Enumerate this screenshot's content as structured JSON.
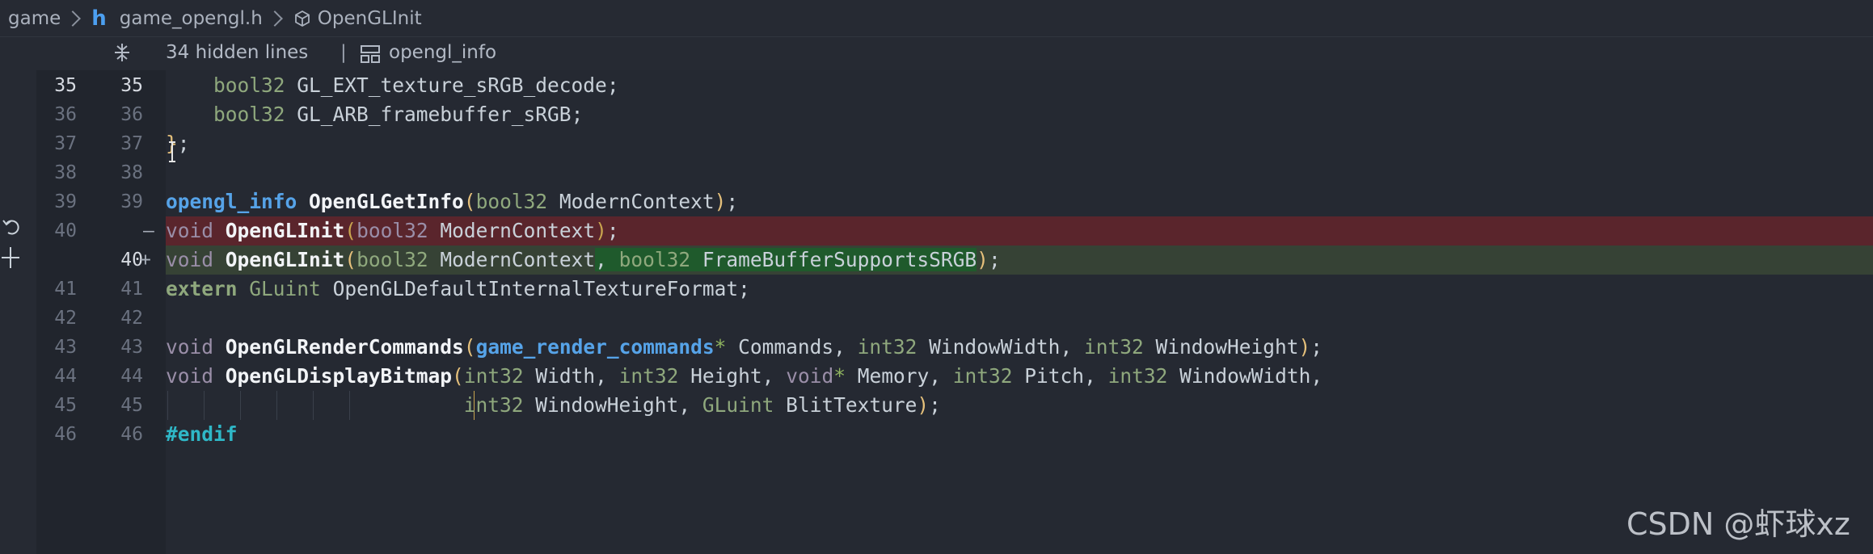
{
  "breadcrumb": {
    "root": "game",
    "file": "game_opengl.h",
    "file_icon": "h",
    "symbol": "OpenGLInit"
  },
  "sticky": {
    "hidden_lines": "34 hidden lines",
    "separator": "|",
    "struct_name": "opengl_info"
  },
  "lines": {
    "l35": {
      "old": "35",
      "new": "35"
    },
    "l36": {
      "old": "36",
      "new": "36"
    },
    "l37": {
      "old": "37",
      "new": "37"
    },
    "l38": {
      "old": "38",
      "new": "38"
    },
    "l39": {
      "old": "39",
      "new": "39"
    },
    "l40r": {
      "old": "40",
      "mark": "—"
    },
    "l40a": {
      "new": "40",
      "mark": "+"
    },
    "l41": {
      "old": "41",
      "new": "41"
    },
    "l42": {
      "old": "42",
      "new": "42"
    },
    "l43": {
      "old": "43",
      "new": "43"
    },
    "l44": {
      "old": "44",
      "new": "44"
    },
    "l45": {
      "old": "45",
      "new": "45"
    },
    "l46": {
      "old": "46",
      "new": "46"
    }
  },
  "code": {
    "bool32": "bool32",
    "void": "void",
    "extern": "extern",
    "int32": "int32",
    "GLuint": "GLuint",
    "l35_name": "GL_EXT_texture_sRGB_decode",
    "l36_name": "GL_ARB_framebuffer_sRGB",
    "semi": ";",
    "brace_close": "}",
    "opengl_info": "opengl_info",
    "OpenGLGetInfo": "OpenGLGetInfo",
    "OpenGLInit": "OpenGLInit",
    "ModernContext": "ModernContext",
    "FrameBufferSupportsSRGB": "FrameBufferSupportsSRGB",
    "OpenGLDefaultInternalTextureFormat": "OpenGLDefaultInternalTextureFormat",
    "OpenGLRenderCommands": "OpenGLRenderCommands",
    "game_render_commands": "game_render_commands",
    "Commands": "Commands",
    "WindowWidth": "WindowWidth",
    "WindowHeight": "WindowHeight",
    "OpenGLDisplayBitmap": "OpenGLDisplayBitmap",
    "Width": "Width",
    "Height": "Height",
    "Memory": "Memory",
    "Pitch": "Pitch",
    "BlitTexture": "BlitTexture",
    "endif": "#endif"
  },
  "watermark": "CSDN @虾球xz",
  "colors": {
    "removed_bg": "#5a252c",
    "added_bg": "#364235",
    "added_highlight": "#1f5a2c",
    "type_blue": "#56a3e8",
    "keyword_green": "#8fa87d",
    "paren_yellow": "#e5c07b"
  },
  "icons": {
    "breadcrumb_sep": "chevron-right-icon",
    "symbol": "cube-icon",
    "fold": "unfold-icon",
    "struct": "struct-icon",
    "revert": "revert-icon",
    "add": "plus-icon",
    "cursor": "text-cursor-icon"
  }
}
